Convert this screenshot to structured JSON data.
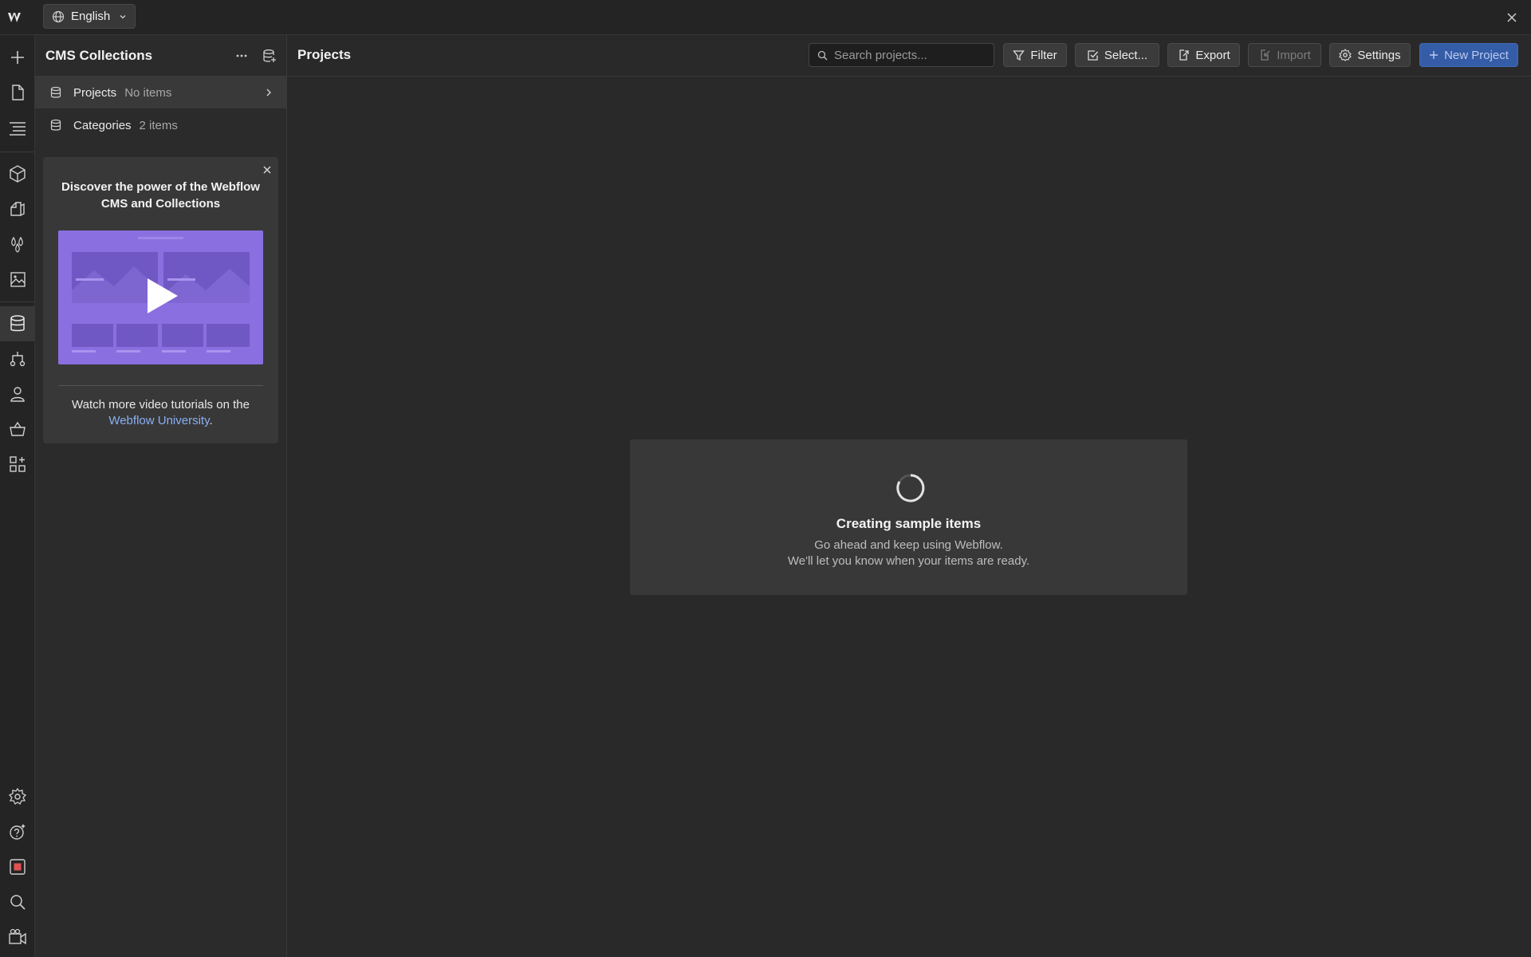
{
  "topbar": {
    "language": "English"
  },
  "rail": {
    "icons": [
      "add-icon",
      "pages-icon",
      "navigator-icon",
      "components-icon",
      "style-selectors-icon",
      "variables-icon",
      "assets-icon",
      "cms-icon",
      "logic-icon",
      "users-icon",
      "ecommerce-icon",
      "apps-icon",
      "settings-icon",
      "help-icon",
      "record-icon",
      "search-icon",
      "video-tutorials-icon"
    ]
  },
  "panel": {
    "title": "CMS Collections",
    "collections": [
      {
        "name": "Projects",
        "count": "No items"
      },
      {
        "name": "Categories",
        "count": "2 items"
      }
    ],
    "promo": {
      "title": "Discover the power of the Webflow CMS and Collections",
      "footer_text": "Watch more video tutorials on the",
      "footer_link": "Webflow University",
      "footer_end": "."
    }
  },
  "main": {
    "title": "Projects",
    "search_placeholder": "Search projects...",
    "buttons": {
      "filter": "Filter",
      "select": "Select...",
      "export": "Export",
      "import": "Import",
      "settings": "Settings",
      "new_project": "New Project"
    },
    "loading": {
      "title": "Creating sample items",
      "line1": "Go ahead and keep using Webflow.",
      "line2": "We'll let you know when your items are ready."
    }
  },
  "colors": {
    "accent": "#355ca6",
    "link": "#8ab0f5",
    "promo_video": "#8a6fe0",
    "record": "#e0524f"
  }
}
